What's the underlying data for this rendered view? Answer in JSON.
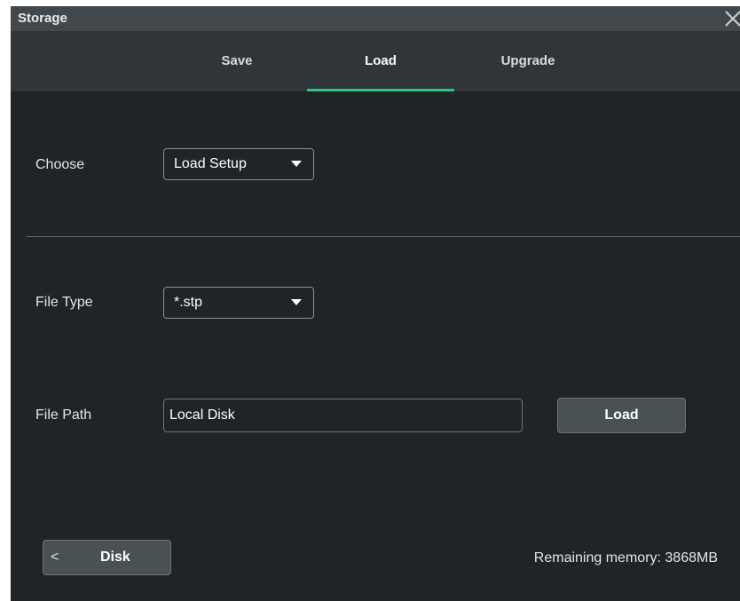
{
  "window": {
    "title": "Storage"
  },
  "tabs": [
    {
      "label": "Save",
      "active": false
    },
    {
      "label": "Load",
      "active": true
    },
    {
      "label": "Upgrade",
      "active": false
    }
  ],
  "choose": {
    "label": "Choose",
    "value": "Load Setup"
  },
  "file_type": {
    "label": "File Type",
    "value": "*.stp"
  },
  "file_path": {
    "label": "File Path",
    "value": "Local Disk",
    "button_label": "Load"
  },
  "footer": {
    "disk_button_icon": "<",
    "disk_button_label": "Disk",
    "remaining_memory": "Remaining memory: 3868MB"
  },
  "colors": {
    "accent": "#2ec47e",
    "background": "#1f2426",
    "titlebar": "#41474a",
    "tabbar": "#2f3538"
  }
}
